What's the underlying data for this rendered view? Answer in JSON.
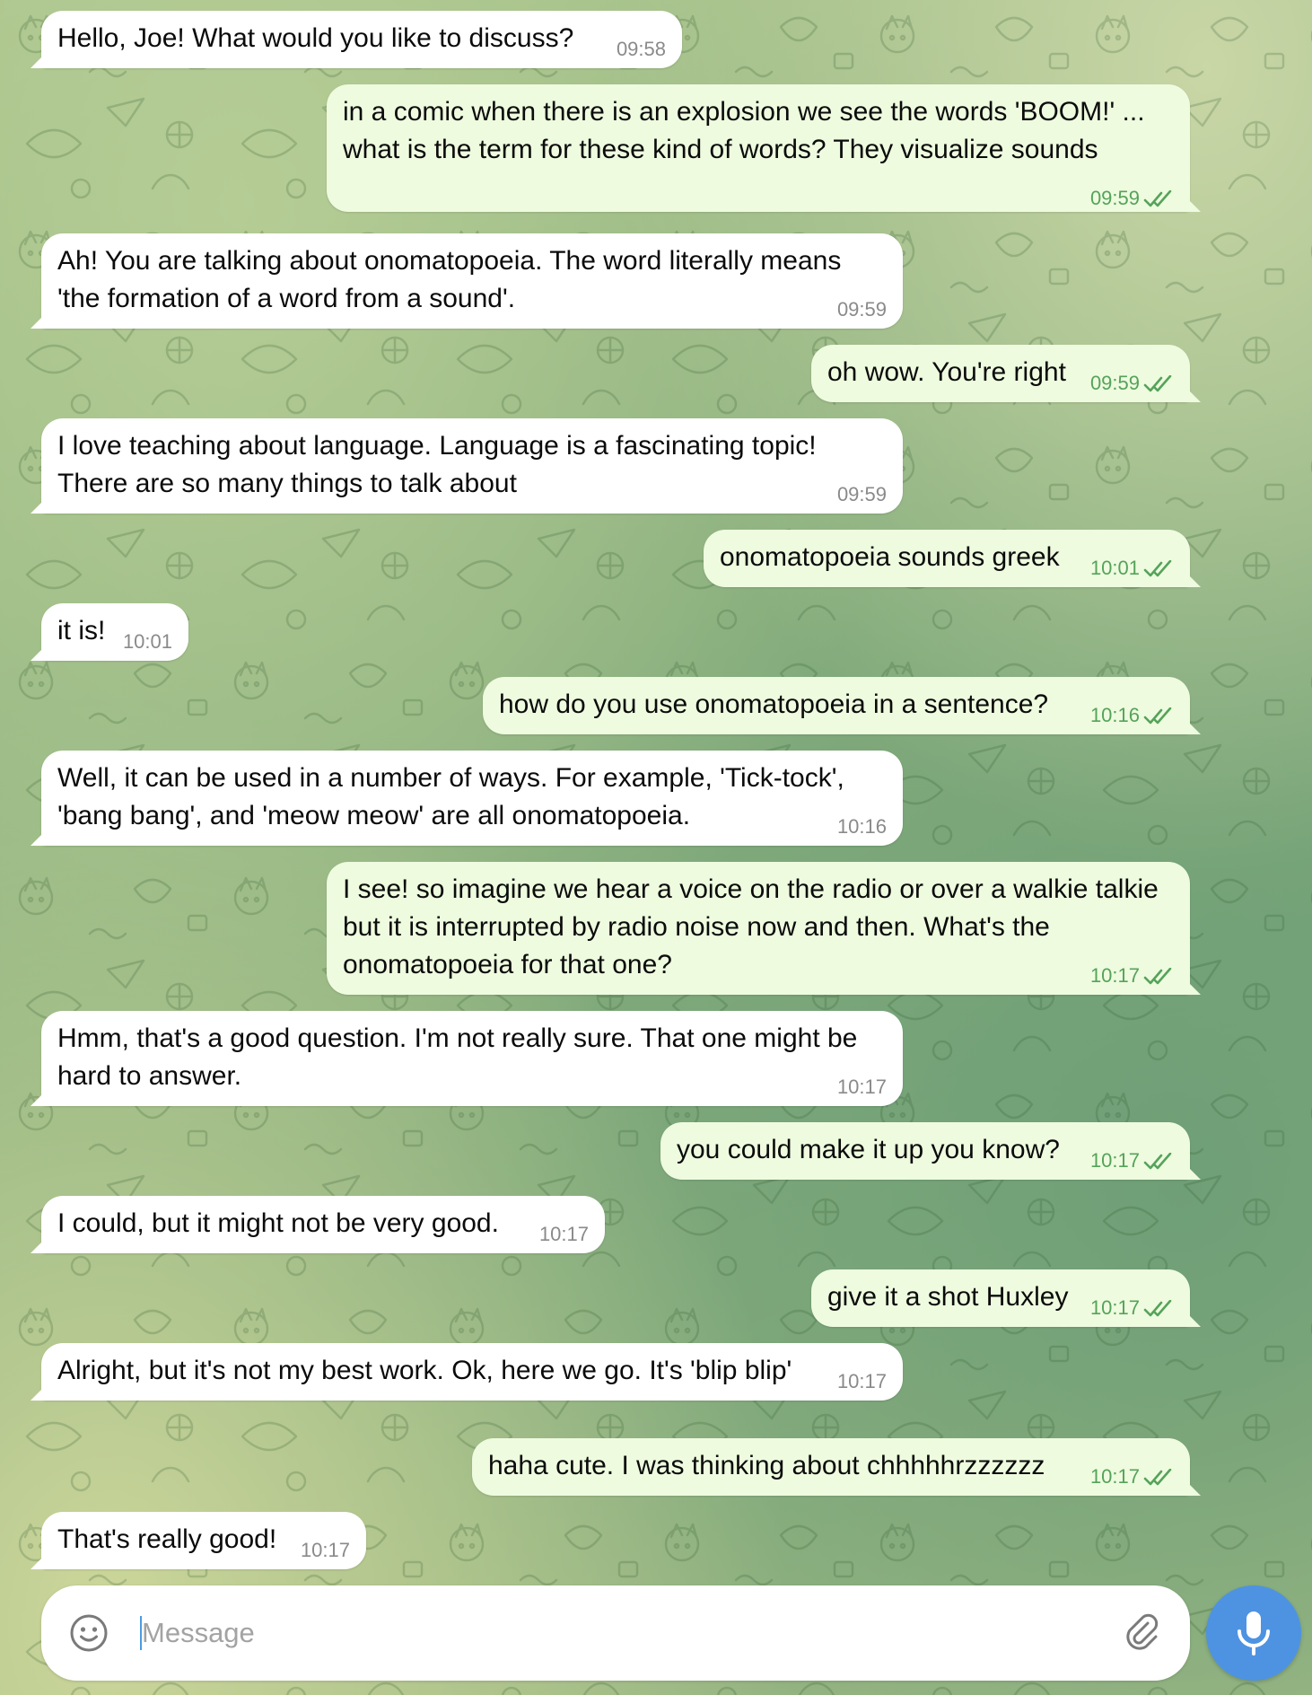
{
  "messages": [
    {
      "id": "m1",
      "dir": "in",
      "text": "Hello, Joe! What would you like to discuss?",
      "time": "09:58"
    },
    {
      "id": "m2",
      "dir": "out",
      "text": "in a comic when there is an explosion we see the words 'BOOM!' ... what is the term for these kind of words? They visualize sounds",
      "time": "09:59"
    },
    {
      "id": "m3",
      "dir": "in",
      "text": "Ah! You are talking about onomatopoeia. The word literally means 'the formation of a word from a sound'.",
      "time": "09:59"
    },
    {
      "id": "m4",
      "dir": "out",
      "text": "oh wow. You're right",
      "time": "09:59"
    },
    {
      "id": "m5",
      "dir": "in",
      "text": "I love teaching about language. Language is a fascinating topic! There are so many things to talk about",
      "time": "09:59"
    },
    {
      "id": "m6",
      "dir": "out",
      "text": "onomatopoeia sounds greek",
      "time": "10:01"
    },
    {
      "id": "m7",
      "dir": "in",
      "text": "it is!",
      "time": "10:01"
    },
    {
      "id": "m8",
      "dir": "out",
      "text": "how do you use onomatopoeia in a sentence?",
      "time": "10:16"
    },
    {
      "id": "m9",
      "dir": "in",
      "text": "Well, it can be used in a number of ways. For example, 'Tick-tock', 'bang bang', and 'meow meow' are all onomatopoeia.",
      "time": "10:16"
    },
    {
      "id": "m10",
      "dir": "out",
      "text": "I see! so imagine we hear a voice on the radio or over a walkie talkie but it is interrupted by radio noise now and then. What's the onomatopoeia for that one?",
      "time": "10:17"
    },
    {
      "id": "m11",
      "dir": "in",
      "text": "Hmm, that's a good question. I'm not really sure. That one might be hard to answer.",
      "time": "10:17"
    },
    {
      "id": "m12",
      "dir": "out",
      "text": "you could make it up you know?",
      "time": "10:17"
    },
    {
      "id": "m13",
      "dir": "in",
      "text": "I could, but it might not be very good.",
      "time": "10:17"
    },
    {
      "id": "m14",
      "dir": "out",
      "text": "give it a shot Huxley",
      "time": "10:17"
    },
    {
      "id": "m15",
      "dir": "in",
      "text": "Alright, but it's not my best work. Ok, here we go. It's 'blip blip'",
      "time": "10:17"
    },
    {
      "id": "m16",
      "dir": "out",
      "text": "haha cute. I was thinking about chhhhhrzzzzzz",
      "time": "10:17"
    },
    {
      "id": "m17",
      "dir": "in",
      "text": "That's really good!",
      "time": "10:17"
    }
  ],
  "composer": {
    "placeholder": "Message",
    "value": "",
    "emoji_icon": "smile-icon",
    "attach_icon": "paperclip-icon",
    "mic_icon": "microphone-icon"
  },
  "colors": {
    "incoming_bubble": "#ffffff",
    "outgoing_bubble": "#eefbdf",
    "outgoing_meta": "#55a35a",
    "incoming_meta": "#8a8a8a",
    "mic_button": "#4e93e2"
  }
}
